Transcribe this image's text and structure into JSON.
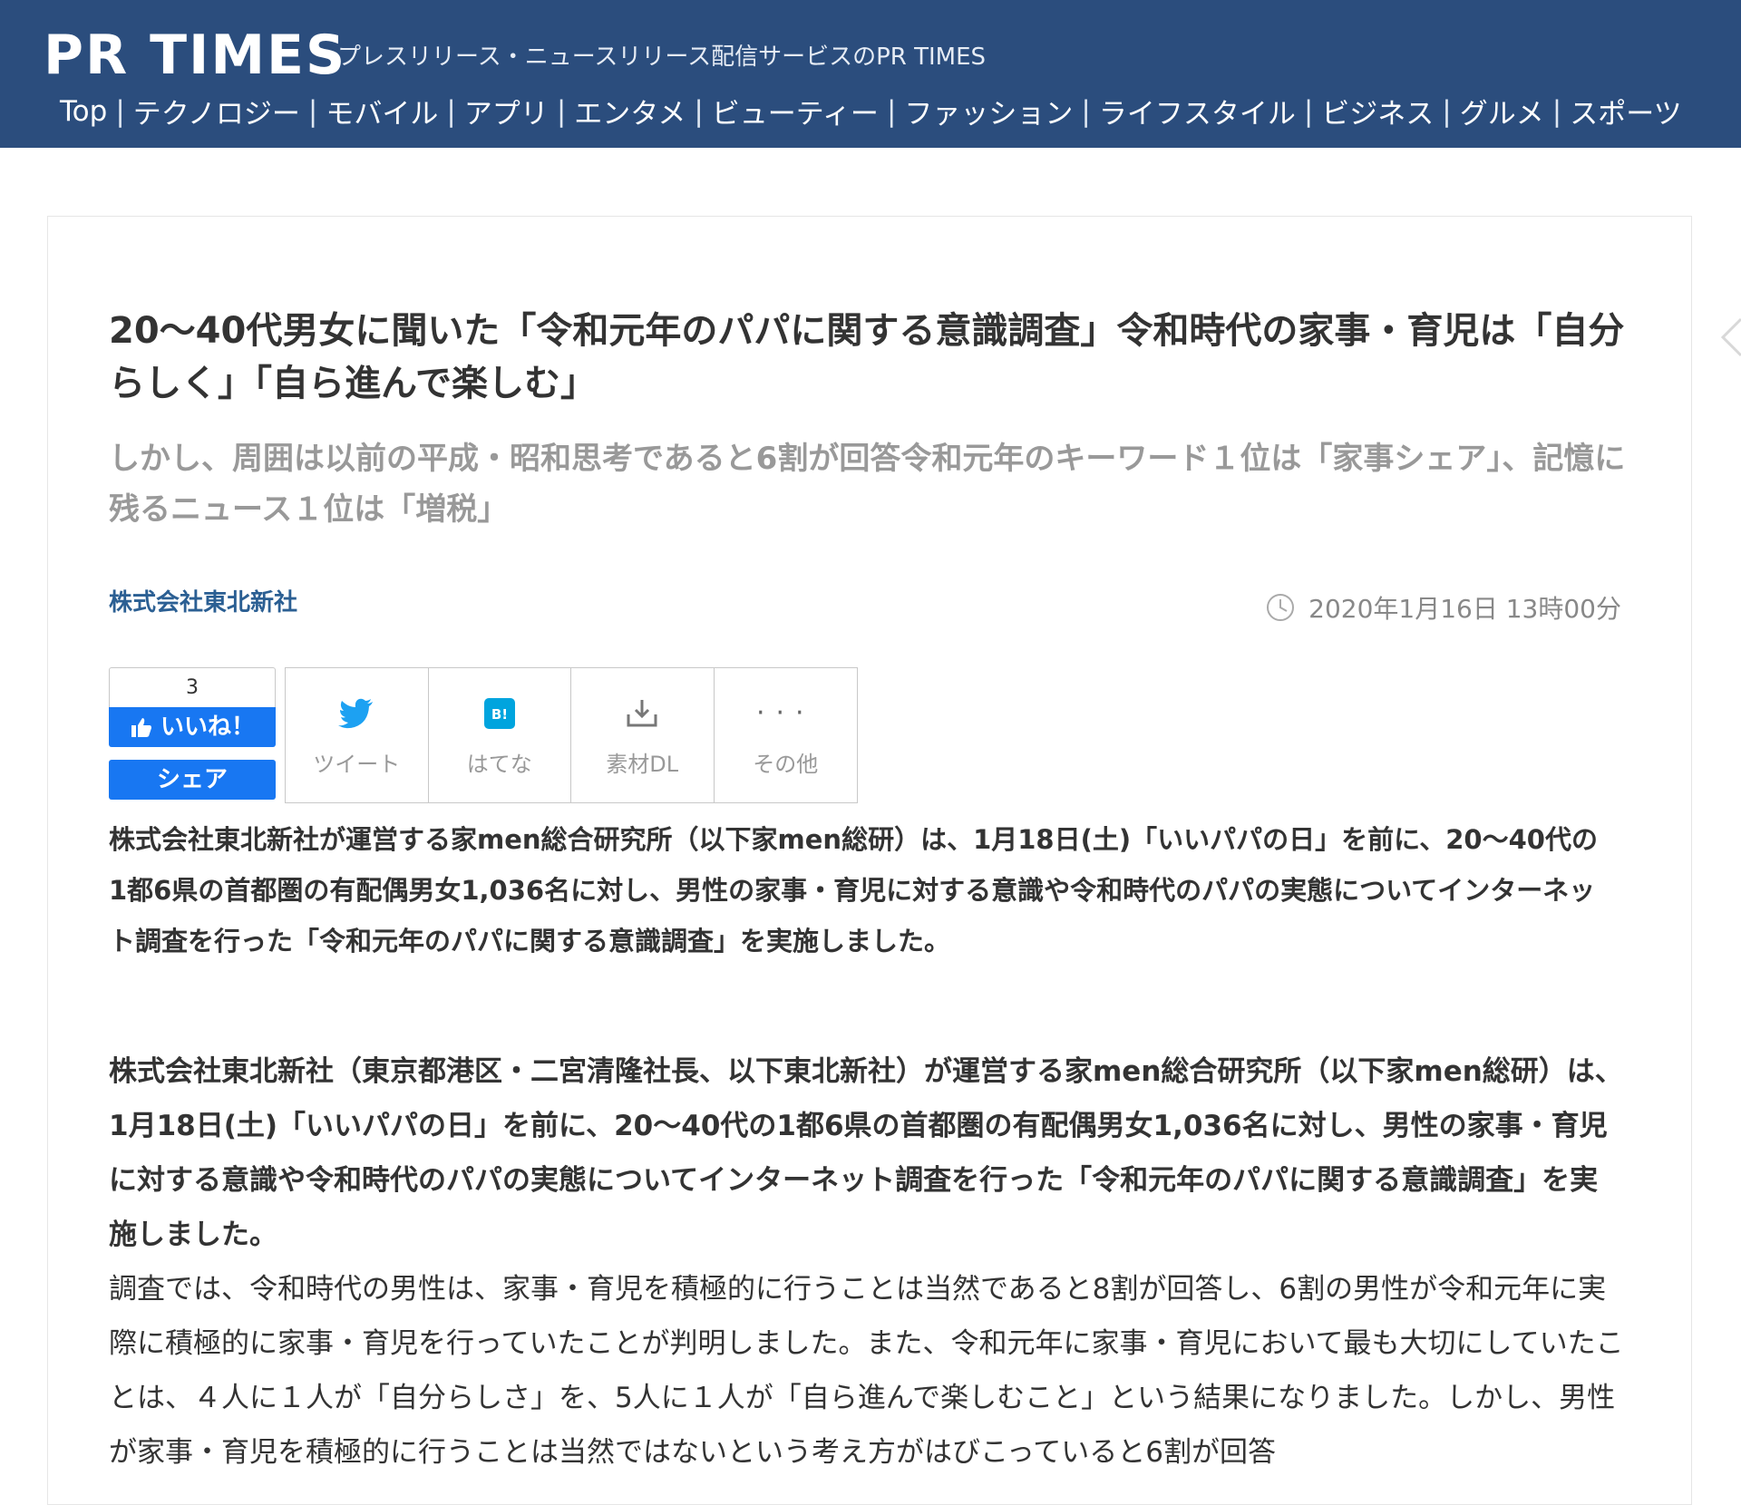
{
  "header": {
    "logo": "PR TIMES",
    "tagline": "プレスリリース・ニュースリリース配信サービスのPR TIMES",
    "nav": [
      "Top",
      "テクノロジー",
      "モバイル",
      "アプリ",
      "エンタメ",
      "ビューティー",
      "ファッション",
      "ライフスタイル",
      "ビジネス",
      "グルメ",
      "スポーツ"
    ],
    "separator": "|",
    "background_color": "#2b4d7d"
  },
  "article": {
    "title": "20～40代男女に聞いた「令和元年のパパに関する意識調査」令和時代の家事・育児は「自分らしく」「自ら進んで楽しむ」",
    "subtitle": "しかし、周囲は以前の平成・昭和思考であると6割が回答令和元年のキーワード１位は「家事シェア」、記憶に残るニュース１位は「増税」",
    "company": "株式会社東北新社",
    "date": "2020年1月16日 13時00分",
    "lead": "株式会社東北新社が運営する家men総合研究所（以下家men総研）は、1月18日(土)「いいパパの日」を前に、20～40代の1都6県の首都圏の有配偶男女1,036名に対し、男性の家事・育児に対する意識や令和時代のパパの実態についてインターネット調査を行った「令和元年のパパに関する意識調査」を実施しました。",
    "body_bold": "株式会社東北新社（東京都港区・二宮清隆社長、以下東北新社）が運営する家men総合研究所（以下家men総研）は、1月18日(土)「いいパパの日」を前に、20～40代の1都6県の首都圏の有配偶男女1,036名に対し、男性の家事・育児に対する意識や令和時代のパパの実態についてインターネット調査を行った「令和元年のパパに関する意識調査」を実施しました。",
    "body_text": "調査では、令和時代の男性は、家事・育児を積極的に行うことは当然であると8割が回答し、6割の男性が令和元年に実際に積極的に家事・育児を行っていたことが判明しました。また、令和元年に家事・育児において最も大切にしていたことは、４人に１人が「自分らしさ」を、5人に１人が「自ら進んで楽しむこと」という結果になりました。しかし、男性が家事・育児を積極的に行うことは当然ではないという考え方がはびこっていると6割が回答"
  },
  "social": {
    "like_count": "3",
    "like_label": "いいね！",
    "share_label": "シェア",
    "buttons": [
      {
        "icon": "twitter-icon",
        "label": "ツイート"
      },
      {
        "icon": "hatena-icon",
        "label": "はてな"
      },
      {
        "icon": "download-icon",
        "label": "素材DL"
      },
      {
        "icon": "more-icon",
        "label": "その他"
      }
    ],
    "facebook_color": "#1877f2",
    "twitter_color": "#1da1f2",
    "hatena_color": "#00a4de"
  }
}
